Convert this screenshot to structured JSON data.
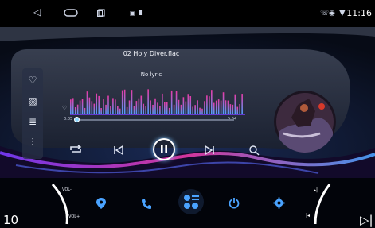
{
  "status_bar": {
    "back_icon": "back-triangle-icon",
    "home_icon": "home-pill-icon",
    "recents_icon": "recents-square-icon",
    "time": "11:16",
    "notification_icons": [
      "screenshot-icon",
      "battery-icon"
    ],
    "system_icons": [
      "phone-icon",
      "location-icon",
      "wifi-icon"
    ]
  },
  "player": {
    "song_title": "02 Holy Diver.flac",
    "lyric_text": "No lyric",
    "time_elapsed": "0:05",
    "time_total": "5:54",
    "progress": 0.014
  },
  "sidebar": {
    "items": [
      {
        "icon": "favorite-heart-icon"
      },
      {
        "icon": "album-art-icon"
      },
      {
        "icon": "playlist-icon"
      },
      {
        "icon": "equalizer-icon"
      }
    ]
  },
  "controls": {
    "repeat": "repeat-icon",
    "previous": "skip-previous-icon",
    "play_pause": "pause-icon",
    "next": "skip-next-icon",
    "search": "search-icon"
  },
  "dock": {
    "vol_minus_label": "VOL-",
    "vol_plus_label": "VOL+",
    "items": [
      "navigation-icon",
      "phone-icon",
      "apps-icon",
      "power-icon",
      "settings-icon"
    ],
    "volume_value": "10"
  },
  "colors": {
    "accent_blue": "#4aa3ff",
    "accent_pink": "#e83aa8",
    "accent_purple": "#7a3cff"
  }
}
